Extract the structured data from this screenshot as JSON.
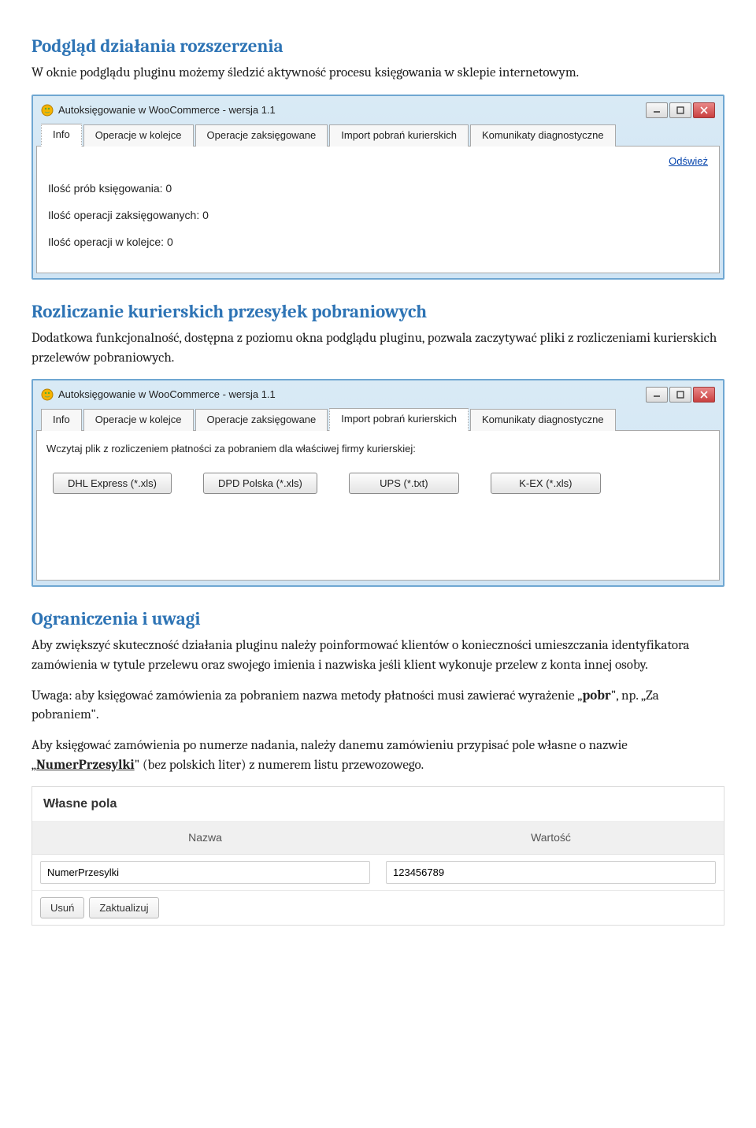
{
  "sections": {
    "preview": {
      "title": "Podgląd działania rozszerzenia",
      "text": "W oknie podglądu pluginu możemy śledzić aktywność procesu księgowania w sklepie internetowym."
    },
    "settlement": {
      "title": "Rozliczanie kurierskich przesyłek pobraniowych",
      "text": "Dodatkowa funkcjonalność, dostępna z poziomu okna podglądu pluginu, pozwala zaczytywać pliki z rozliczeniami kurierskich przelewów pobraniowych."
    },
    "limits": {
      "title": "Ograniczenia i uwagi",
      "p1": "Aby zwiększyć skuteczność działania pluginu należy poinformować klientów o konieczności umieszczania identyfikatora zamówienia w tytule przelewu oraz swojego imienia i nazwiska jeśli klient wykonuje przelew z konta innej osoby.",
      "p2_pre": "Uwaga: aby księgować zamówienia za pobraniem nazwa metody płatności musi zawierać wyrażenie „",
      "p2_bold": "pobr",
      "p2_post": "\", np. „Za pobraniem\".",
      "p3_pre": "Aby księgować zamówienia po numerze nadania, należy danemu zamówieniu przypisać pole własne o nazwie „",
      "p3_bold": "NumerPrzesylki",
      "p3_post": "\" (bez polskich liter) z numerem listu przewozowego."
    }
  },
  "app": {
    "title": "Autoksięgowanie w WooCommerce - wersja 1.1",
    "tabs": {
      "info": "Info",
      "queue": "Operacje w kolejce",
      "posted": "Operacje zaksięgowane",
      "import": "Import pobrań kurierskich",
      "diag": "Komunikaty diagnostyczne"
    },
    "info_pane": {
      "refresh": "Odśwież",
      "line1": "Ilość prób księgowania: 0",
      "line2": "Ilość operacji zaksięgowanych: 0",
      "line3": "Ilość operacji w kolejce: 0"
    },
    "import_pane": {
      "prompt": "Wczytaj plik z rozliczeniem płatności za pobraniem dla właściwej firmy kurierskiej:",
      "buttons": {
        "dhl": "DHL Express (*.xls)",
        "dpd": "DPD Polska (*.xls)",
        "ups": "UPS (*.txt)",
        "kex": "K-EX (*.xls)"
      }
    }
  },
  "wp": {
    "panel_title": "Własne pola",
    "head_name": "Nazwa",
    "head_value": "Wartość",
    "row_name": "NumerPrzesylki",
    "row_value": "123456789",
    "btn_delete": "Usuń",
    "btn_update": "Zaktualizuj"
  }
}
